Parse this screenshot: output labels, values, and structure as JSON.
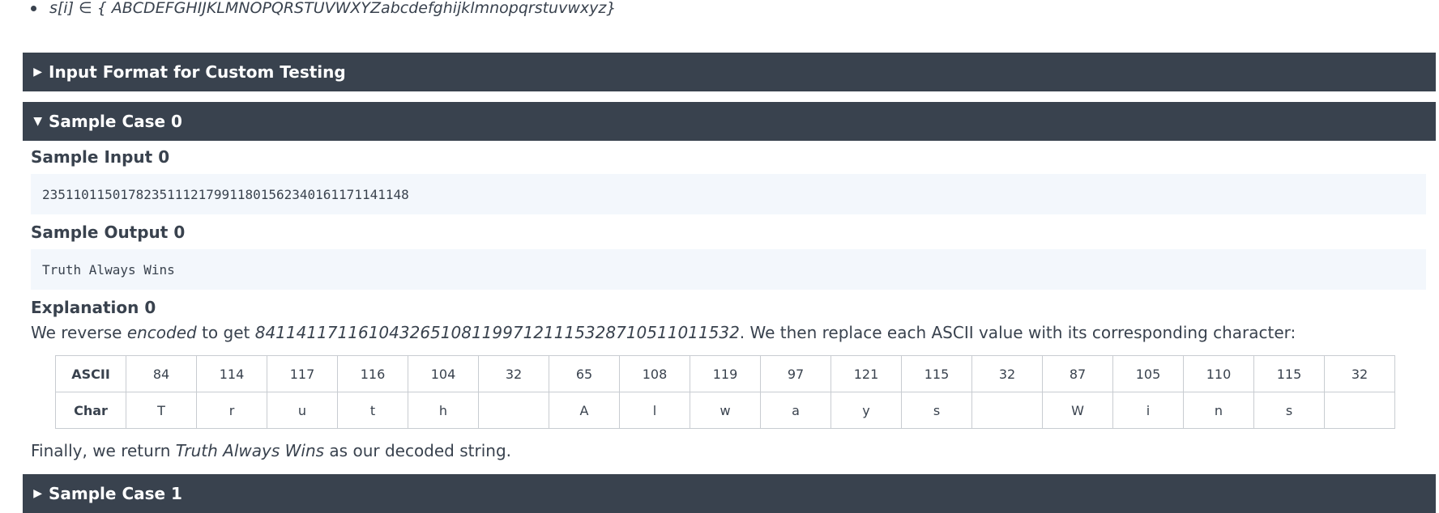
{
  "constraint": {
    "text": "s[i]  ∈ { ABCDEFGHIJKLMNOPQRSTUVWXYZabcdefghijklmnopqrstuvwxyz}"
  },
  "sections": {
    "input_format": {
      "label": "Input Format for Custom Testing",
      "icon": "triangle-right-icon"
    },
    "sample_case_0": {
      "label": "Sample Case 0",
      "icon": "triangle-down-icon"
    },
    "sample_case_1": {
      "label": "Sample Case 1",
      "icon": "triangle-right-icon"
    }
  },
  "sample0": {
    "input_title": "Sample Input 0",
    "input_value": "23511011501782351112179911801562340161171141148",
    "output_title": "Sample Output 0",
    "output_value": "Truth Always Wins",
    "explanation_title": "Explanation 0",
    "explanation": {
      "part1": "We reverse ",
      "em1": "encoded",
      "part2": " to get ",
      "em2": "84114117116104326510811997121115328710511011532",
      "part3": ". We then replace each ASCII value with its corresponding character:"
    },
    "table": {
      "row1_header": "ASCII",
      "row2_header": "Char",
      "ascii": [
        "84",
        "114",
        "117",
        "116",
        "104",
        "32",
        "65",
        "108",
        "119",
        "97",
        "121",
        "115",
        "32",
        "87",
        "105",
        "110",
        "115",
        "32"
      ],
      "chars": [
        "T",
        "r",
        "u",
        "t",
        "h",
        "",
        "A",
        "l",
        "w",
        "a",
        "y",
        "s",
        "",
        "W",
        "i",
        "n",
        "s",
        ""
      ]
    },
    "final": {
      "part1": "Finally, we return ",
      "em": "Truth Always Wins ",
      "part2": " as our decoded string."
    }
  }
}
